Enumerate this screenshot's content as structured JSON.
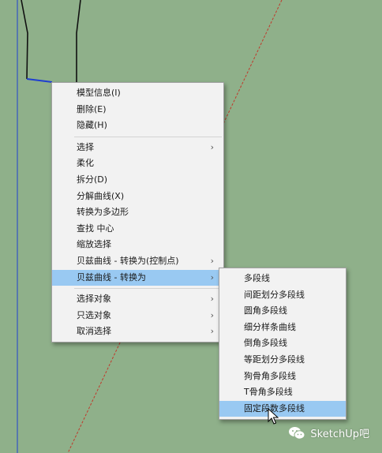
{
  "colors": {
    "background": "#8fb08a",
    "menu_background": "#f2f2f2",
    "highlight": "#99c9f2",
    "red_axis": "#c0392b",
    "blue_axis": "#1f3fd0"
  },
  "context_menu": {
    "group1": [
      {
        "label": "模型信息(I)"
      },
      {
        "label": "删除(E)"
      },
      {
        "label": "隐藏(H)"
      }
    ],
    "group2": [
      {
        "label": "选择",
        "arrow": "›"
      },
      {
        "label": "柔化"
      },
      {
        "label": "拆分(D)"
      },
      {
        "label": "分解曲线(X)"
      },
      {
        "label": "转换为多边形"
      },
      {
        "label": "查找 中心"
      },
      {
        "label": "缩放选择"
      },
      {
        "label": "贝兹曲线 - 转换为(控制点)",
        "arrow": "›"
      },
      {
        "label": "贝兹曲线 - 转换为",
        "arrow": "›",
        "highlighted": true
      }
    ],
    "group3": [
      {
        "label": "选择对象",
        "arrow": "›"
      },
      {
        "label": "只选对象",
        "arrow": "›"
      },
      {
        "label": "取消选择",
        "arrow": "›"
      }
    ]
  },
  "submenu": {
    "items": [
      {
        "label": "多段线"
      },
      {
        "label": "间距划分多段线"
      },
      {
        "label": "圆角多段线"
      },
      {
        "label": "细分样条曲线"
      },
      {
        "label": "倒角多段线"
      },
      {
        "label": "等距划分多段线"
      },
      {
        "label": "狗骨角多段线"
      },
      {
        "label": "T骨角多段线"
      },
      {
        "label": "固定段数多段线",
        "highlighted": true
      }
    ]
  },
  "watermark": {
    "text": "SketchUp吧",
    "icon": "wechat-icon"
  }
}
